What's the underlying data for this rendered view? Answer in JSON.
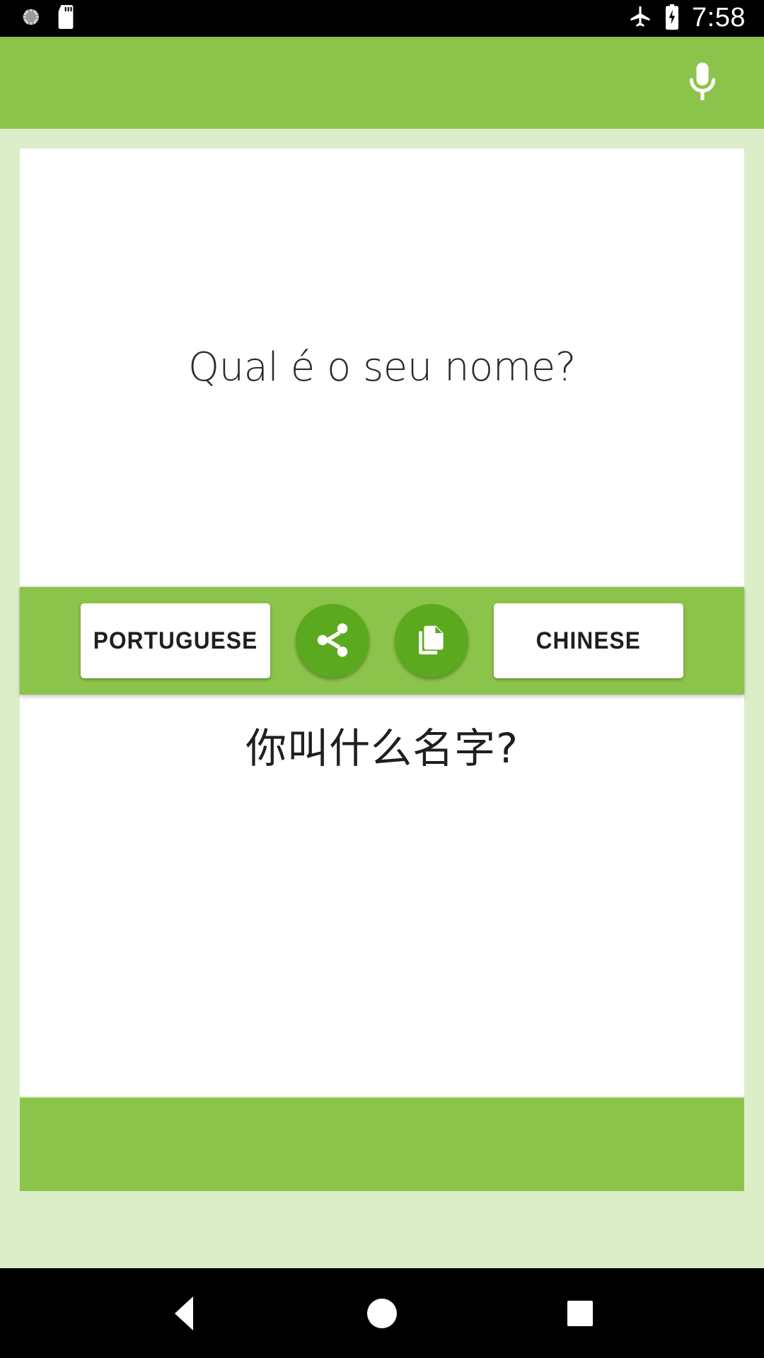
{
  "status_bar": {
    "icons_left": [
      "screenshot-icon",
      "sd-card-icon"
    ],
    "icons_right": [
      "airplane-mode-icon",
      "battery-charging-icon"
    ],
    "time": "7:58"
  },
  "app_bar": {
    "mic_label": "microphone-icon",
    "background_color": "#8cc34a"
  },
  "source": {
    "text": "Qual é o seu nome?",
    "language_label": "PORTUGUESE"
  },
  "target": {
    "text": "你叫什么名字?",
    "language_label": "CHINESE"
  },
  "actions": {
    "share_label": "share-icon",
    "copy_label": "copy-icon"
  },
  "nav_bar": {
    "back_label": "Back",
    "home_label": "Home",
    "recents_label": "Recents"
  },
  "colors": {
    "accent_green": "#8cc34a",
    "dark_green": "#5aa91e",
    "page_background": "#dceec9",
    "card_white": "#ffffff"
  }
}
